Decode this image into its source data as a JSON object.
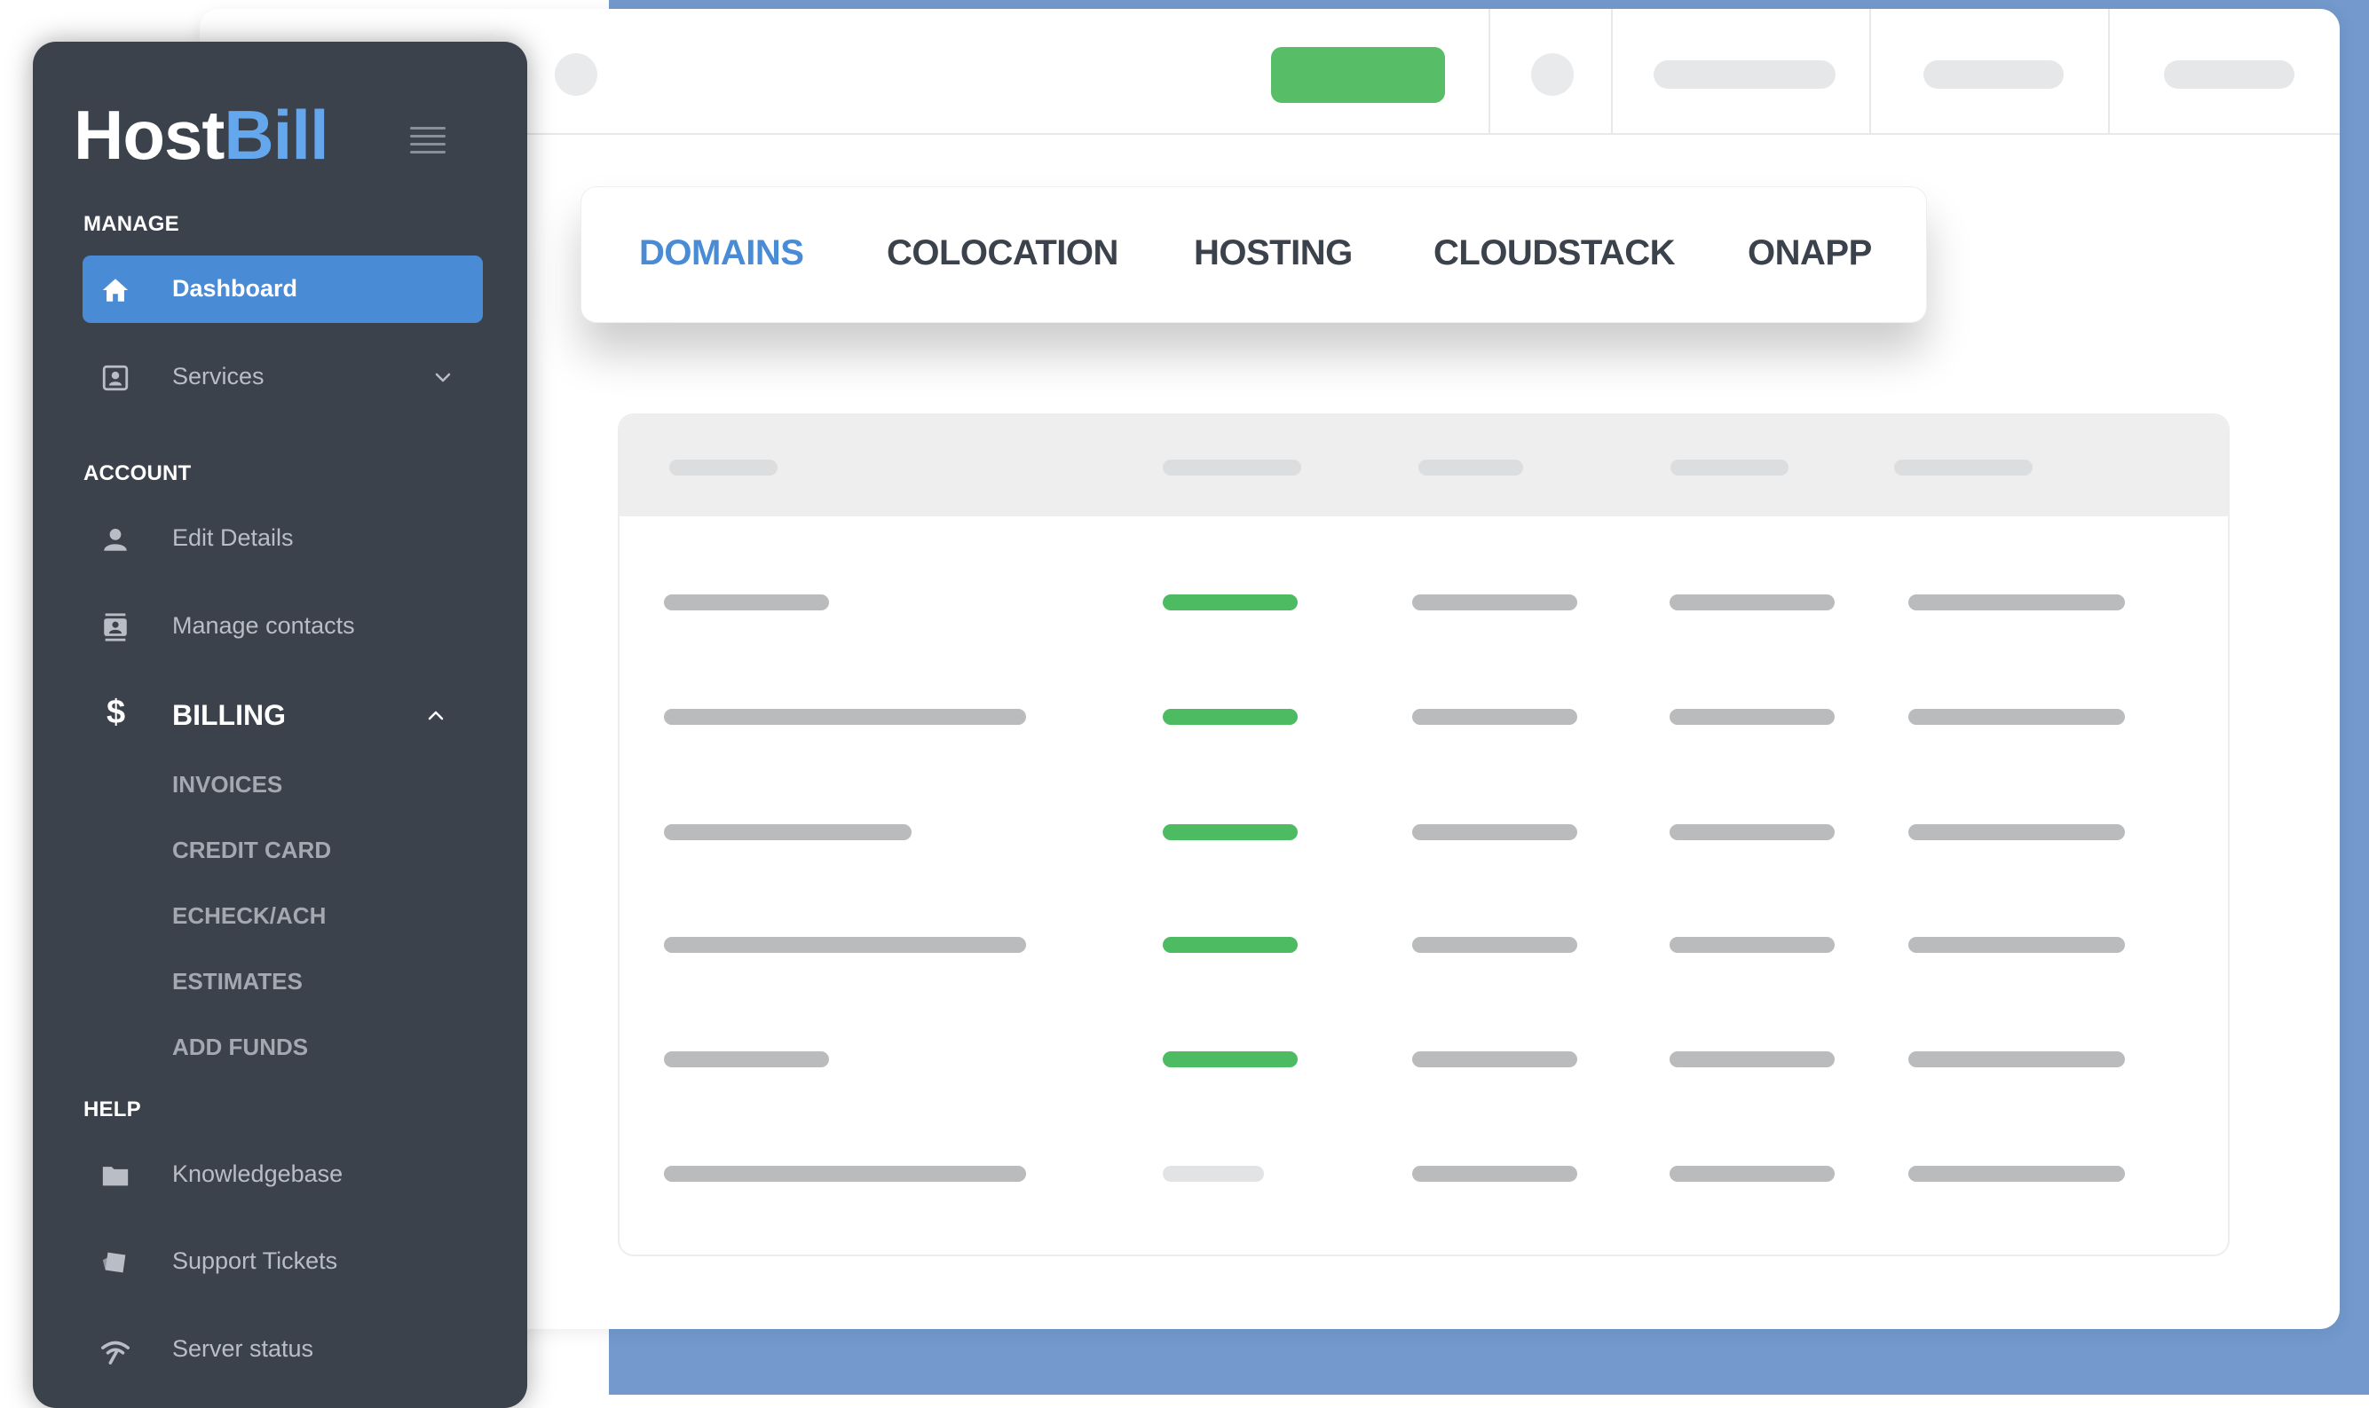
{
  "brand": {
    "name_part1": "Host",
    "name_part2": "Bill"
  },
  "sidebar": {
    "sections": {
      "manage": "MANAGE",
      "account": "ACCOUNT",
      "help": "HELP"
    },
    "items": {
      "dashboard": "Dashboard",
      "services": "Services",
      "edit_details": "Edit Details",
      "manage_contacts": "Manage contacts",
      "billing": "BILLING",
      "knowledgebase": "Knowledgebase",
      "support_tickets": "Support Tickets",
      "server_status": "Server status"
    },
    "billing_sub": {
      "invoices": "INVOICES",
      "credit_card": "CREDIT CARD",
      "echeck": "ECHECK/ACH",
      "estimates": "ESTIMATES",
      "add_funds": "ADD FUNDS"
    }
  },
  "tabs": {
    "domains": "DOMAINS",
    "colocation": "COLOCATION",
    "hosting": "HOSTING",
    "cloudstack": "CLOUDSTACK",
    "onapp": "ONAPP",
    "active": "DOMAINS"
  },
  "colors": {
    "accent": "#4a8bd6",
    "sidebar_bg": "#3b424c",
    "status_green": "#4cbb62",
    "page_bg": "#7399cd"
  },
  "icons": [
    "home-icon",
    "services-icon",
    "chevron-down-icon",
    "user-icon",
    "contacts-icon",
    "dollar-icon",
    "chevron-up-icon",
    "folder-icon",
    "tickets-icon",
    "signal-icon",
    "hamburger-menu-icon"
  ]
}
